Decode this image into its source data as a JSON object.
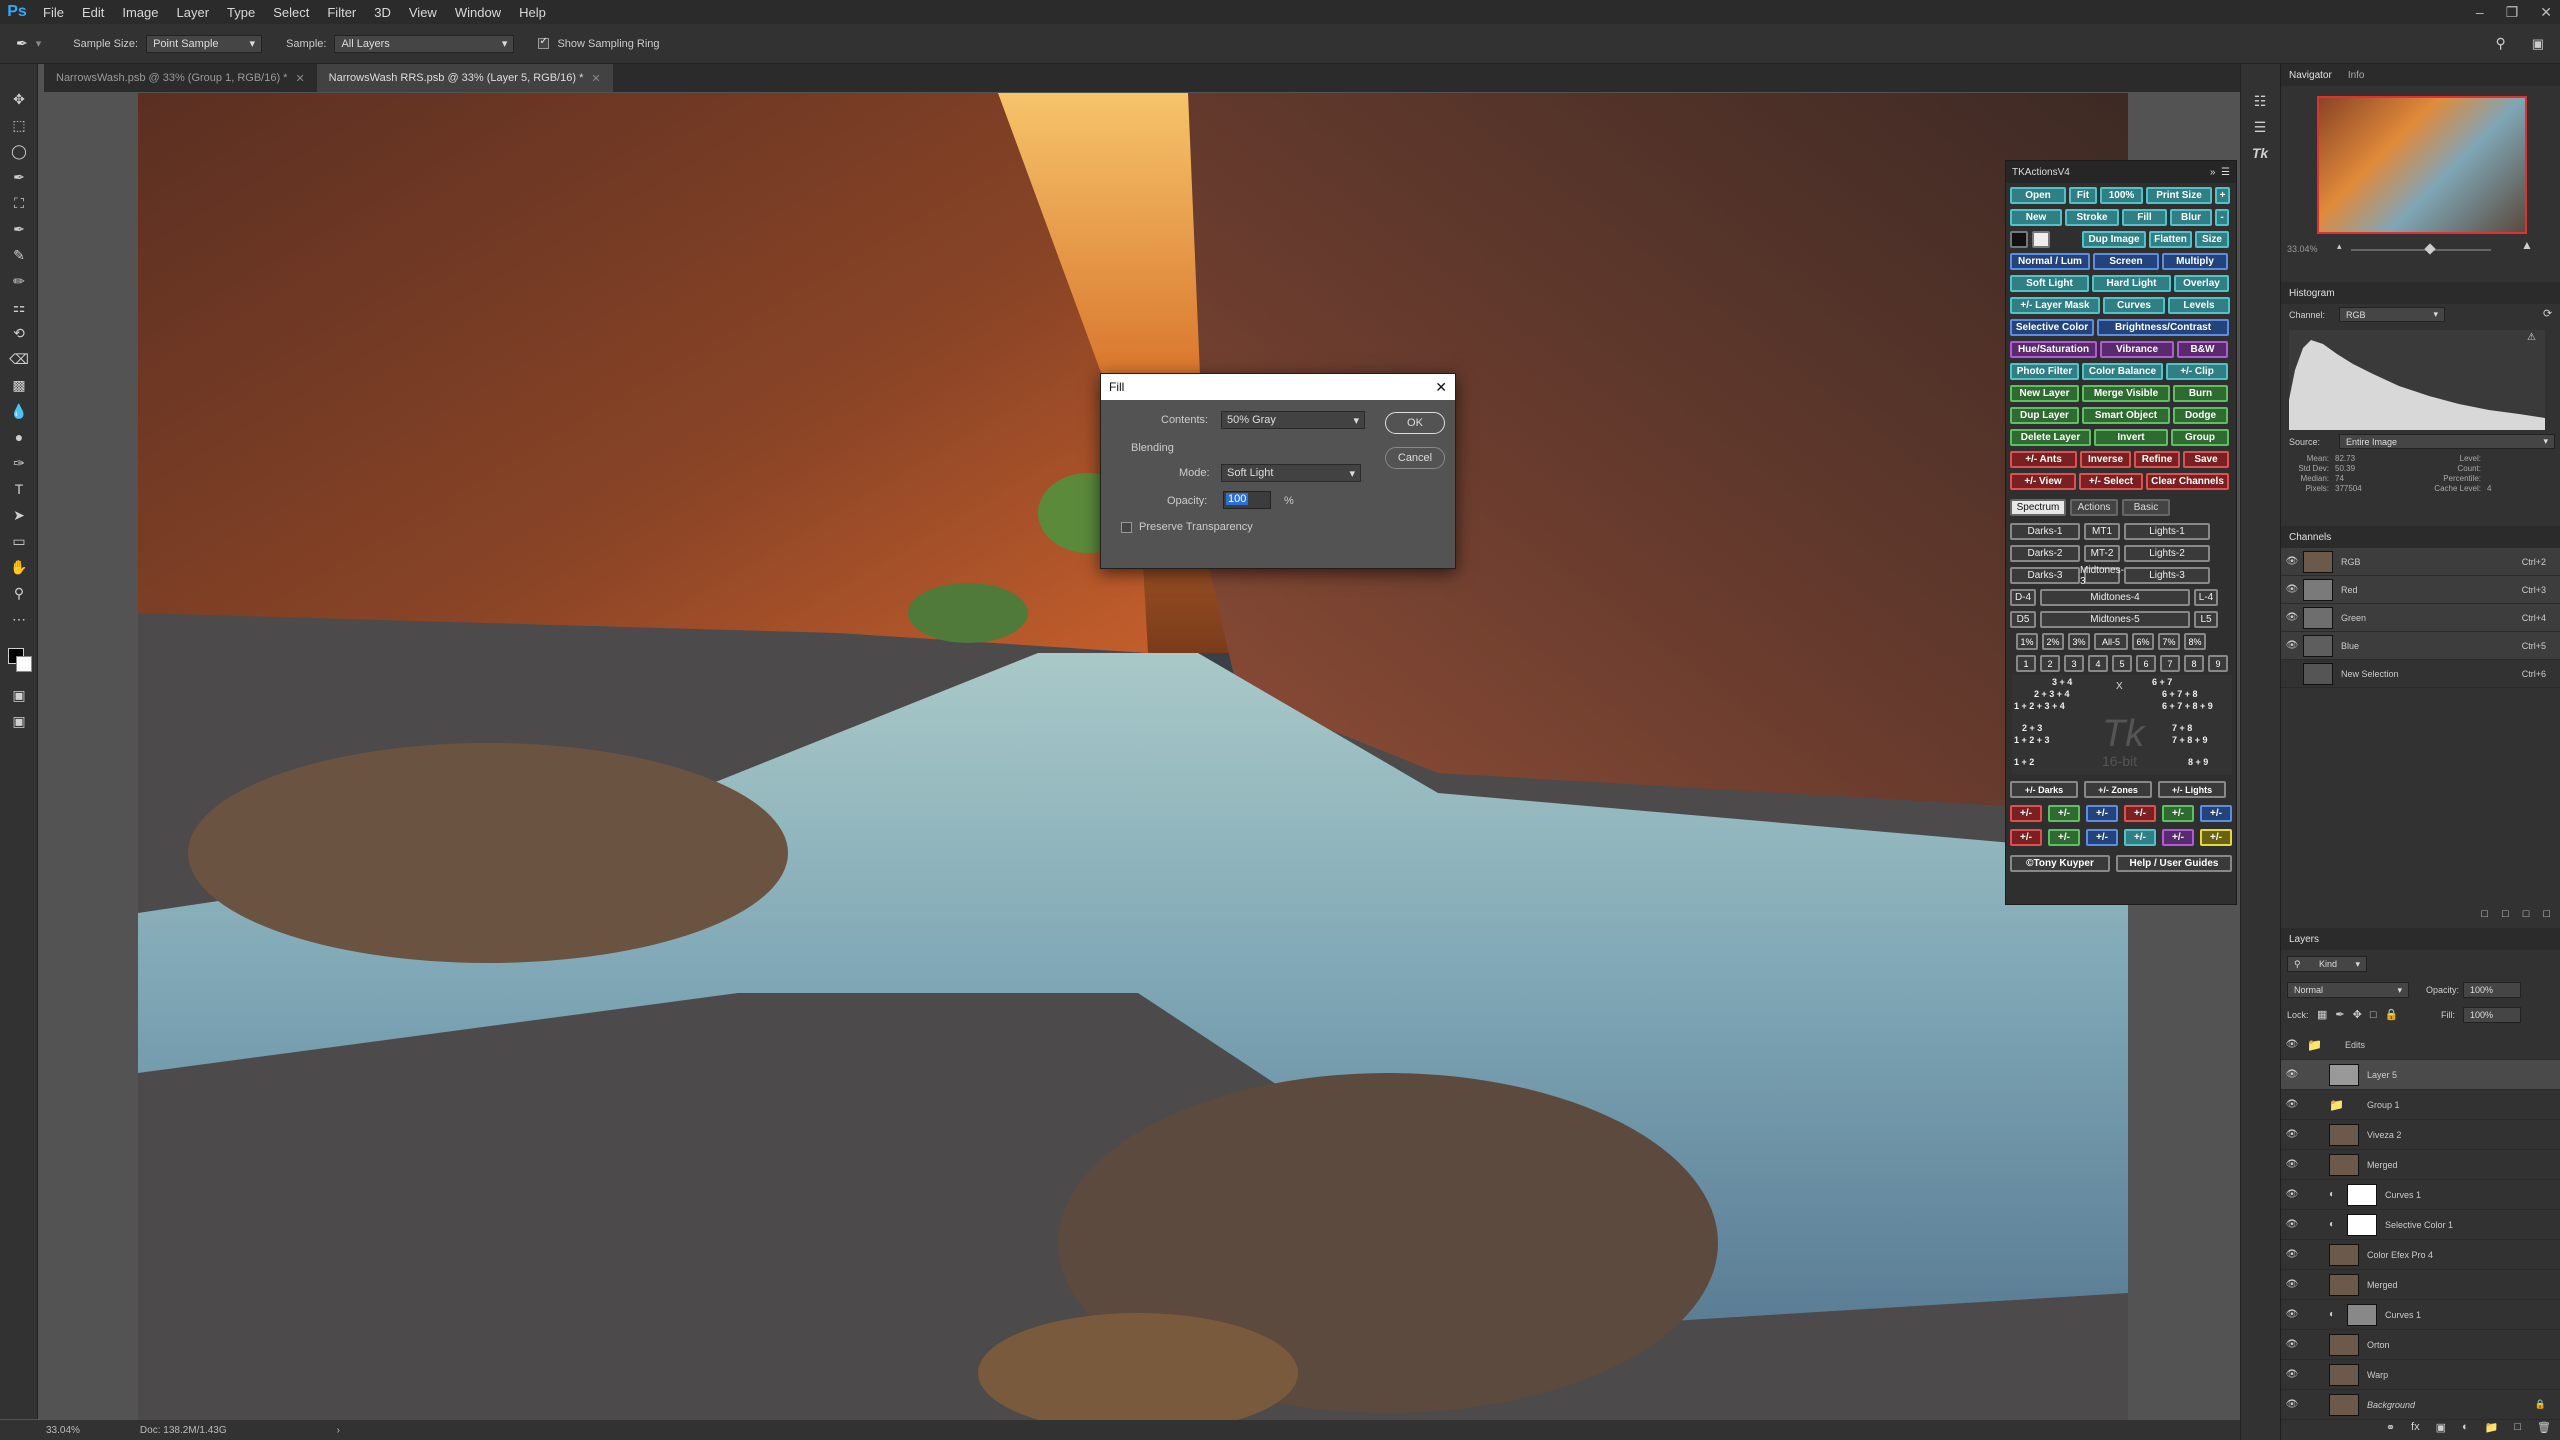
{
  "menu": [
    "File",
    "Edit",
    "Image",
    "Layer",
    "Type",
    "Select",
    "Filter",
    "3D",
    "View",
    "Window",
    "Help"
  ],
  "app_logo": "Ps",
  "options": {
    "sample_size_label": "Sample Size:",
    "sample_size_value": "Point Sample",
    "sample_label": "Sample:",
    "sample_value": "All Layers",
    "show_ring_label": "Show Sampling Ring"
  },
  "tabs": [
    {
      "label": "NarrowsWash.psb @ 33% (Group 1, RGB/16) *"
    },
    {
      "label": "NarrowsWash RRS.psb @ 33% (Layer 5, RGB/16) *"
    }
  ],
  "status": {
    "zoom": "33.04%",
    "doc": "Doc: 138.2M/1.43G"
  },
  "dialog": {
    "title": "Fill",
    "contents_label": "Contents:",
    "contents_value": "50% Gray",
    "blending_label": "Blending",
    "mode_label": "Mode:",
    "mode_value": "Soft Light",
    "opacity_label": "Opacity:",
    "opacity_value": "100",
    "opacity_unit": "%",
    "preserve_label": "Preserve Transparency",
    "ok": "OK",
    "cancel": "Cancel"
  },
  "tk": {
    "title": "TKActionsV4",
    "rows": [
      [
        "Open",
        "Fit",
        "100%",
        "Print Size",
        "+"
      ],
      [
        "New",
        "Stroke",
        "Fill",
        "Blur",
        "-"
      ],
      [
        "Dup Image",
        "Flatten",
        "Size"
      ],
      [
        "Normal / Lum",
        "Screen",
        "Multiply"
      ],
      [
        "Soft Light",
        "Hard Light",
        "Overlay"
      ],
      [
        "+/- Layer Mask",
        "Curves",
        "Levels"
      ],
      [
        "Selective Color",
        "Brightness/Contrast"
      ],
      [
        "Hue/Saturation",
        "Vibrance",
        "B&W"
      ],
      [
        "Photo Filter",
        "Color Balance",
        "+/- Clip"
      ],
      [
        "New Layer",
        "Merge Visible",
        "Burn"
      ],
      [
        "Dup Layer",
        "Smart Object",
        "Dodge"
      ],
      [
        "Delete Layer",
        "Invert",
        "Group"
      ],
      [
        "+/- Ants",
        "Inverse",
        "Refine",
        "Save"
      ],
      [
        "+/- View",
        "+/- Select",
        "Clear Channels"
      ]
    ],
    "tabs": [
      "Spectrum",
      "Actions",
      "Basic"
    ],
    "zones": [
      [
        "Darks-1",
        "MT1",
        "Lights-1"
      ],
      [
        "Darks-2",
        "MT-2",
        "Lights-2"
      ],
      [
        "Darks-3",
        "Midtones-3",
        "Lights-3"
      ],
      [
        "D-4",
        "Midtones-4",
        "L-4"
      ],
      [
        "D5",
        "Midtones-5",
        "L5"
      ]
    ],
    "percents": [
      "1%",
      "2%",
      "3%",
      "All-5",
      "6%",
      "7%",
      "8%"
    ],
    "digits": [
      "1",
      "2",
      "3",
      "4",
      "5",
      "6",
      "7",
      "8",
      "9"
    ],
    "combos_left": [
      "3 + 4",
      "2 + 3 + 4",
      "1 + 2 + 3 + 4",
      "2 + 3",
      "1 + 2 + 3",
      "1 + 2"
    ],
    "combos_right": [
      "6 + 7",
      "6 + 7 + 8",
      "6 + 7 + 8 + 9",
      "7 + 8",
      "7 + 8 + 9",
      "8 + 9"
    ],
    "x_label": "X",
    "watermark": "16-bit",
    "logo": "Tk",
    "bottom": [
      "+/- Darks",
      "+/- Zones",
      "+/- Lights"
    ],
    "pm": "+/-",
    "footer": [
      "©Tony Kuyper",
      "Help / User Guides"
    ]
  },
  "navigator": {
    "tabs": [
      "Navigator",
      "Info"
    ],
    "zoom": "33.04%"
  },
  "histogram": {
    "title": "Histogram",
    "channel_label": "Channel:",
    "channel_value": "RGB",
    "source_label": "Source:",
    "source_value": "Entire Image",
    "stats_left": [
      [
        "Mean:",
        "82.73"
      ],
      [
        "Std Dev:",
        "50.39"
      ],
      [
        "Median:",
        "74"
      ],
      [
        "Pixels:",
        "377504"
      ]
    ],
    "stats_right": [
      [
        "Level:",
        ""
      ],
      [
        "Count:",
        ""
      ],
      [
        "Percentile:",
        ""
      ],
      [
        "Cache Level:",
        "4"
      ]
    ]
  },
  "channels": {
    "title": "Channels",
    "items": [
      {
        "name": "RGB",
        "key": "Ctrl+2"
      },
      {
        "name": "Red",
        "key": "Ctrl+3"
      },
      {
        "name": "Green",
        "key": "Ctrl+4"
      },
      {
        "name": "Blue",
        "key": "Ctrl+5"
      },
      {
        "name": "New Selection",
        "key": "Ctrl+6"
      }
    ]
  },
  "layers": {
    "title": "Layers",
    "kind": "Kind",
    "blend": "Normal",
    "opacity_label": "Opacity:",
    "opacity_value": "100%",
    "lock_label": "Lock:",
    "fill_label": "Fill:",
    "fill_value": "100%",
    "items": [
      {
        "name": "Edits",
        "type": "group"
      },
      {
        "name": "Layer 5",
        "type": "layer"
      },
      {
        "name": "Group 1",
        "type": "group"
      },
      {
        "name": "Viveza 2",
        "type": "layer"
      },
      {
        "name": "Merged",
        "type": "layer"
      },
      {
        "name": "Curves 1",
        "type": "adj"
      },
      {
        "name": "Selective Color 1",
        "type": "adj"
      },
      {
        "name": "Color Efex Pro 4",
        "type": "layer"
      },
      {
        "name": "Merged",
        "type": "layer"
      },
      {
        "name": "Curves 1",
        "type": "adj"
      },
      {
        "name": "Orton",
        "type": "layer"
      },
      {
        "name": "Warp",
        "type": "layer"
      },
      {
        "name": "Background",
        "type": "bg"
      }
    ]
  },
  "colors": {
    "accent": "#31a8ff",
    "teal": "#3fa3a8",
    "green": "#4caf50",
    "purple": "#8e44ad",
    "red": "#c0392b",
    "yellow": "#d4c21a",
    "blue": "#3a6fc4"
  }
}
